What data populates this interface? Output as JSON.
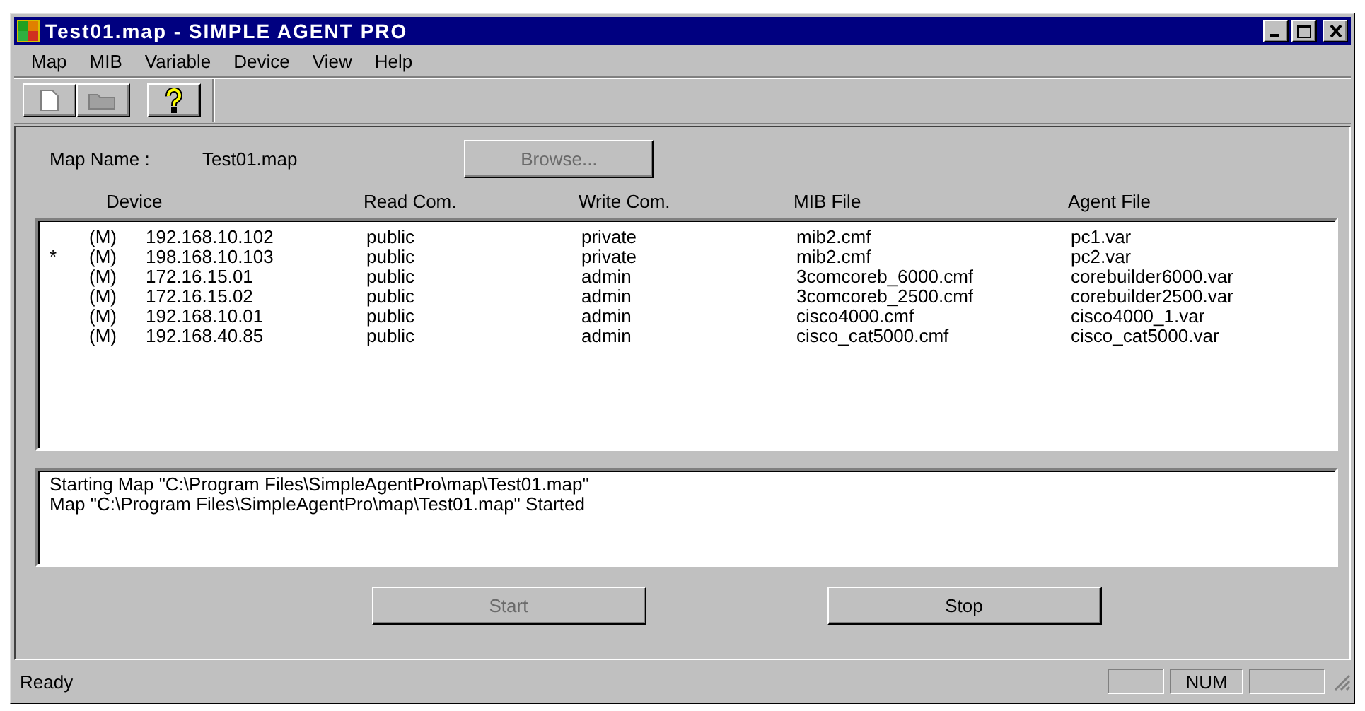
{
  "window": {
    "title": "Test01.map - SIMPLE AGENT PRO"
  },
  "menu": [
    "Map",
    "MIB",
    "Variable",
    "Device",
    "View",
    "Help"
  ],
  "map_name": {
    "label": "Map Name :",
    "value": "Test01.map"
  },
  "browse_button": {
    "label": "Browse...",
    "disabled": true
  },
  "table": {
    "columns": [
      "Device",
      "Read Com.",
      "Write Com.",
      "MIB File",
      "Agent File"
    ],
    "rows": [
      {
        "type": "(M)",
        "device": "192.168.10.102",
        "read": "public",
        "write": "private",
        "mib": "mib2.cmf",
        "agent": "pc1.var"
      },
      {
        "marker": "*",
        "type": "(M)",
        "device": "198.168.10.103",
        "read": "public",
        "write": "private",
        "mib": "mib2.cmf",
        "agent": "pc2.var"
      },
      {
        "type": "(M)",
        "device": "172.16.15.01",
        "read": "public",
        "write": "admin",
        "mib": "3comcoreb_6000.cmf",
        "agent": "corebuilder6000.var"
      },
      {
        "type": "(M)",
        "device": "172.16.15.02",
        "read": "public",
        "write": "admin",
        "mib": "3comcoreb_2500.cmf",
        "agent": "corebuilder2500.var"
      },
      {
        "type": "(M)",
        "device": "192.168.10.01",
        "read": "public",
        "write": "admin",
        "mib": "cisco4000.cmf",
        "agent": "cisco4000_1.var"
      },
      {
        "type": "(M)",
        "device": "192.168.40.85",
        "read": "public",
        "write": "admin",
        "mib": "cisco_cat5000.cmf",
        "agent": "cisco_cat5000.var"
      }
    ]
  },
  "log": [
    "Starting Map \"C:\\Program Files\\SimpleAgentPro\\map\\Test01.map\"",
    "Map \"C:\\Program Files\\SimpleAgentPro\\map\\Test01.map\" Started"
  ],
  "buttons": [
    {
      "label": "Start",
      "disabled": true
    },
    {
      "label": "Stop",
      "disabled": false
    }
  ],
  "status_bar": {
    "text": "Ready",
    "indicator": "NUM"
  }
}
